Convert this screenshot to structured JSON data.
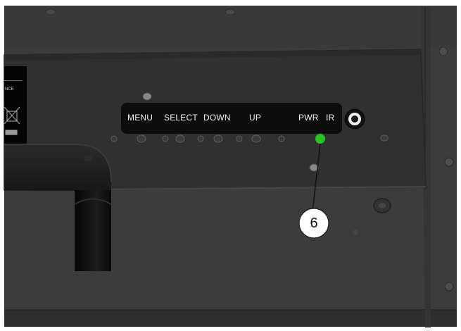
{
  "control_panel": {
    "buttons": [
      {
        "label": "MENU"
      },
      {
        "label": "SELECT"
      },
      {
        "label": "DOWN"
      },
      {
        "label": "UP"
      }
    ],
    "power_label": "PWR",
    "ir_label": "IR",
    "power_led_color": "#27c21f"
  },
  "sticker": {
    "text": "NCE",
    "icon": "weee-crossed-bin-icon"
  },
  "callout": {
    "number": "6"
  },
  "colors": {
    "panel": "#3a3a3a",
    "recess": "#2f2f2f",
    "label_strip": "#0d0d0d",
    "stand": "#121212"
  }
}
